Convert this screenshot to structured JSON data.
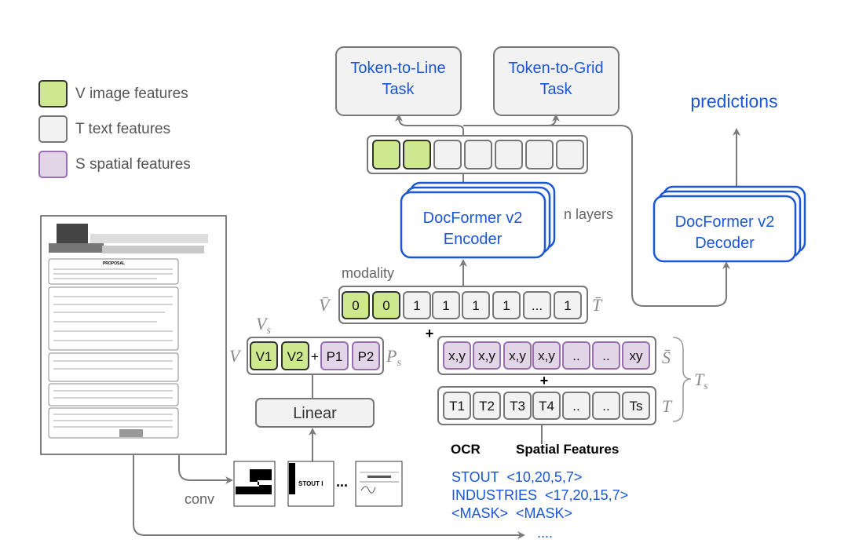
{
  "colors": {
    "visual": "#cde88e",
    "text": "#f2f2f2",
    "spatial": "#e3d5e8",
    "spatial_border": "#9a6fb0",
    "accent": "#1a56d6"
  },
  "legend": [
    {
      "label": "V image features",
      "color": "#cde88e"
    },
    {
      "label": "T text features",
      "color": "#f2f2f2"
    },
    {
      "label": "S spatial features",
      "color": "#e3d5e8"
    }
  ],
  "tasks": {
    "line": [
      "Token-to-Line",
      "Task"
    ],
    "grid": [
      "Token-to-Grid",
      "Task"
    ]
  },
  "predictions": "predictions",
  "encoder": {
    "lines": [
      "DocFormer v2",
      "Encoder"
    ],
    "layers_label": "n layers"
  },
  "decoder": {
    "lines": [
      "DocFormer v2",
      "Decoder"
    ]
  },
  "modality": {
    "label": "modality",
    "cells": [
      "0",
      "0",
      "1",
      "1",
      "1",
      "1",
      "...",
      "1"
    ],
    "left_symbol": "V̄",
    "right_symbol": "T̄"
  },
  "spatial_row": {
    "cells": [
      "x,y",
      "x,y",
      "x,y",
      "x,y",
      "..",
      "..",
      "xy"
    ],
    "symbol": "S̄"
  },
  "text_row": {
    "cells": [
      "T1",
      "T2",
      "T3",
      "T4",
      "..",
      "..",
      "Ts"
    ],
    "symbol": "T"
  },
  "ts_symbol": "T",
  "ts_sub": "s",
  "visual_row": {
    "cells": [
      "V1",
      "V2"
    ],
    "plus": "+",
    "pos_cells": [
      "P1",
      "P2"
    ],
    "left_symbol": "V",
    "top_symbol": "V",
    "top_sub": "s",
    "right_symbol": "P",
    "right_sub": "s"
  },
  "plus": "+",
  "linear": "Linear",
  "conv": "conv",
  "patches_ellipsis": "...",
  "ocr_label": "OCR",
  "spatial_label": "Spatial Features",
  "ocr_lines": [
    "STOUT  <10,20,5,7>",
    "INDUSTRIES  <17,20,15,7>",
    "<MASK>  <MASK>",
    "...."
  ],
  "document": {
    "heading": "PROPOSAL",
    "patch_text": "STOUT I"
  }
}
